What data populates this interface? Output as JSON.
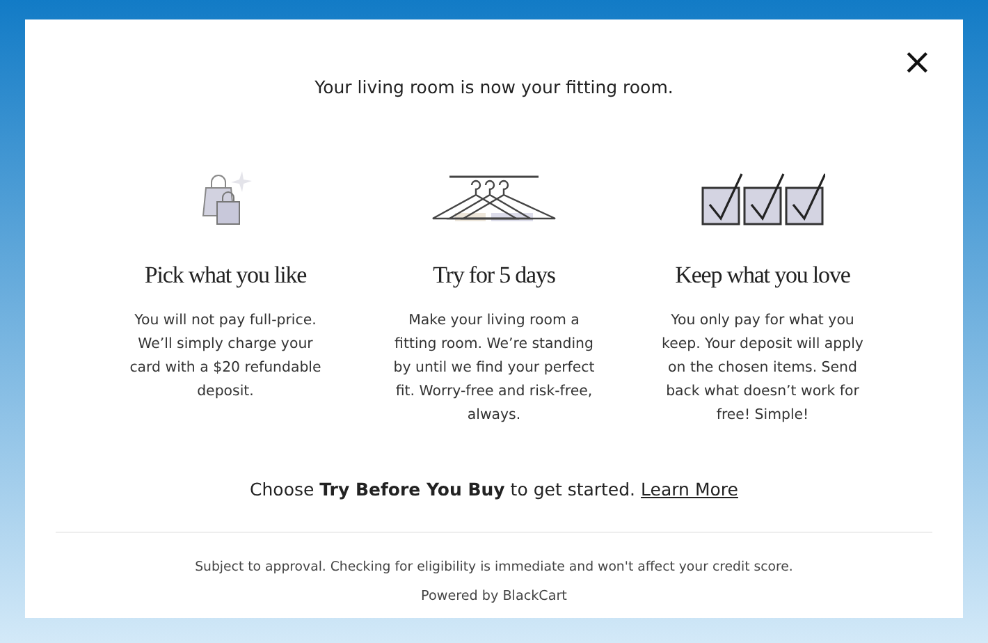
{
  "modal": {
    "close": "×",
    "title": "Your living room is now your fitting room.",
    "features": [
      {
        "kind": "bags",
        "heading": "Pick what you like",
        "text": "You will not pay full-price. We’ll simply charge your card with a $20 refundable deposit."
      },
      {
        "kind": "hangers",
        "heading": "Try for 5 days",
        "text": "Make your living room a fitting room. We’re standing by until we find your perfect fit. Worry-free and risk-free, always."
      },
      {
        "kind": "checks",
        "heading": "Keep what you love",
        "text": "You only pay for what you keep. Your deposit will apply on the chosen items. Send back what doesn’t work for free! Simple!"
      }
    ],
    "cta": "Choose **Try Before You Buy** to get started.",
    "link": "Learn More",
    "disclaimer": "Subject to approval. Checking for eligibility is immediate and won't affect your credit score.",
    "powered_by": "Powered by BlackCart"
  }
}
